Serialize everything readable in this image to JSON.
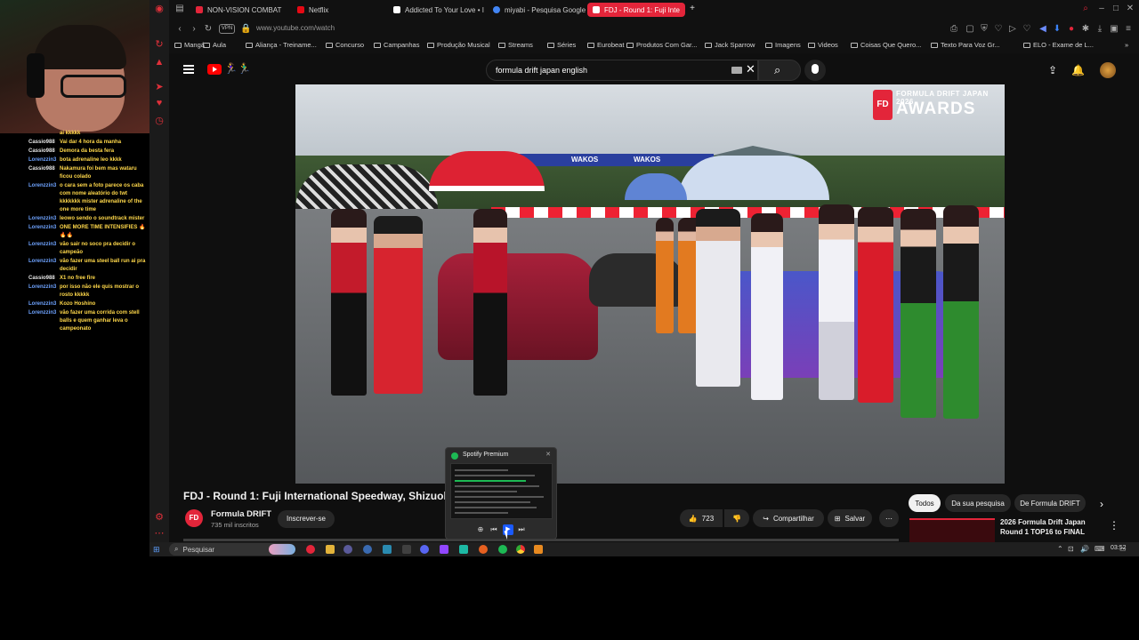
{
  "stream_chat": [
    {
      "user": "",
      "msg": "ai kkkkk"
    },
    {
      "user": "Cassio988",
      "msg": "Vai dar 4 hora da manha"
    },
    {
      "user": "Cassio988",
      "msg": "Demora da besta fera"
    },
    {
      "user": "Lorenzzin3",
      "msg": "bota adrenaline leo kkkk"
    },
    {
      "user": "Cassio988",
      "msg": "Nakamura foi bem mas wataru ficou colado"
    },
    {
      "user": "Lorenzzin3",
      "msg": "o cara sem a foto parece os caba com nome aleatório do twt kkkkkkk mister adrenaline of the one more time"
    },
    {
      "user": "Lorenzzin3",
      "msg": "leowo sendo o soundtrack mister"
    },
    {
      "user": "Lorenzzin3",
      "msg": "ONE MORE TIME INTENSIFIES 🔥🔥🔥"
    },
    {
      "user": "Lorenzzin3",
      "msg": "vão sair no soco pra decidir o campeão"
    },
    {
      "user": "Lorenzzin3",
      "msg": "vão fazer uma steel ball run ai pra decidir"
    },
    {
      "user": "Cassio988",
      "msg": "X1 no free fire"
    },
    {
      "user": "Lorenzzin3",
      "msg": "por isso não ele quis mostrar o rosto kkkkk"
    },
    {
      "user": "Lorenzzin3",
      "msg": "Kozo Hoshino"
    },
    {
      "user": "Lorenzzin3",
      "msg": "vão fazer uma corrida com stell balls e quem ganhar leva o campeonato"
    }
  ],
  "tabs": [
    {
      "label": "NON-VISION COMBAT",
      "color": "#e3253a"
    },
    {
      "label": "Netflix",
      "color": "#e50914"
    },
    {
      "label": "Addicted To Your Love • I",
      "color": "#ffffff"
    },
    {
      "label": "miyabi - Pesquisa Google",
      "color": "#4285f4"
    },
    {
      "label": "FDJ - Round 1: Fuji Inte",
      "color": "#ffffff"
    }
  ],
  "address": {
    "url": "www.youtube.com/watch",
    "vpn": "VPN"
  },
  "bookmarks": [
    "Mangá",
    "Aula",
    "Aliança - Treiname...",
    "Concurso",
    "Campanhas",
    "Produção Musical",
    "Streams",
    "Séries",
    "Eurobeat",
    "Produtos Com Gar...",
    "Jack Sparrow",
    "Imagens",
    "Videos",
    "Coisas Que Quero...",
    "Texto Para Voz Gr...",
    "ELO - Exame de L..."
  ],
  "youtube": {
    "search_query": "formula drift japan english",
    "doodle": "🏃‍♀️🏃‍♂️",
    "video": {
      "badge_title": "FORMULA DRIFT JAPAN 2026",
      "badge_awards": "AWARDS",
      "badge_logo": "FD",
      "sign_left": "WAKOS",
      "sign_right": "WAKOS"
    },
    "title": "FDJ - Round 1: Fuji International Speedway, Shizuoka - T",
    "channel": {
      "logo": "FD",
      "name": "Formula DRIFT",
      "subs": "735 mil inscritos"
    },
    "subscribe": "Inscrever-se",
    "likes": "723",
    "share": "Compartilhar",
    "save": "Salvar",
    "chips": [
      "Todos",
      "Da sua pesquisa",
      "De Formula DRIFT"
    ],
    "recommendation": {
      "title": "2026 Formula Drift Japan Round 1 TOP16 to FINAL"
    }
  },
  "spotify": {
    "title": "Spotify Premium"
  },
  "taskbar": {
    "search": "Pesquisar",
    "clock": "03:52"
  }
}
